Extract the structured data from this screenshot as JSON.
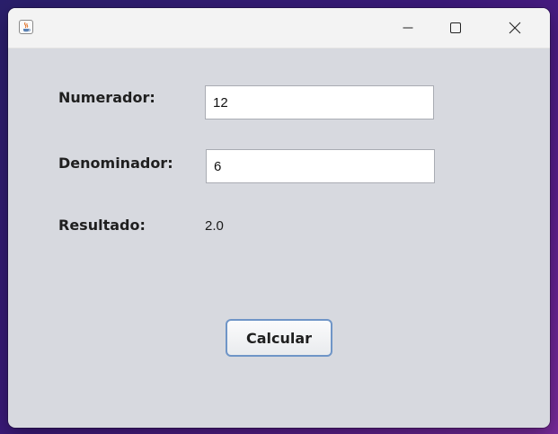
{
  "window": {
    "title": "",
    "controls": {
      "minimize_icon": "minimize-icon",
      "maximize_icon": "maximize-icon",
      "close_icon": "close-icon"
    },
    "app_icon": "java-coffee-cup-icon"
  },
  "form": {
    "numerador_label": "Numerador:",
    "numerador_value": "12",
    "denominador_label": "Denominador:",
    "denominador_value": "6",
    "resultado_label": "Resultado:",
    "resultado_value": "2.0",
    "calcular_label": "Calcular"
  },
  "colors": {
    "window_background": "#d7d9df",
    "titlebar_background": "#f3f3f3",
    "button_focus_border": "#6f95c7",
    "desktop_gradient_start": "#2a1f6b",
    "desktop_gradient_end": "#7a2a9c"
  }
}
